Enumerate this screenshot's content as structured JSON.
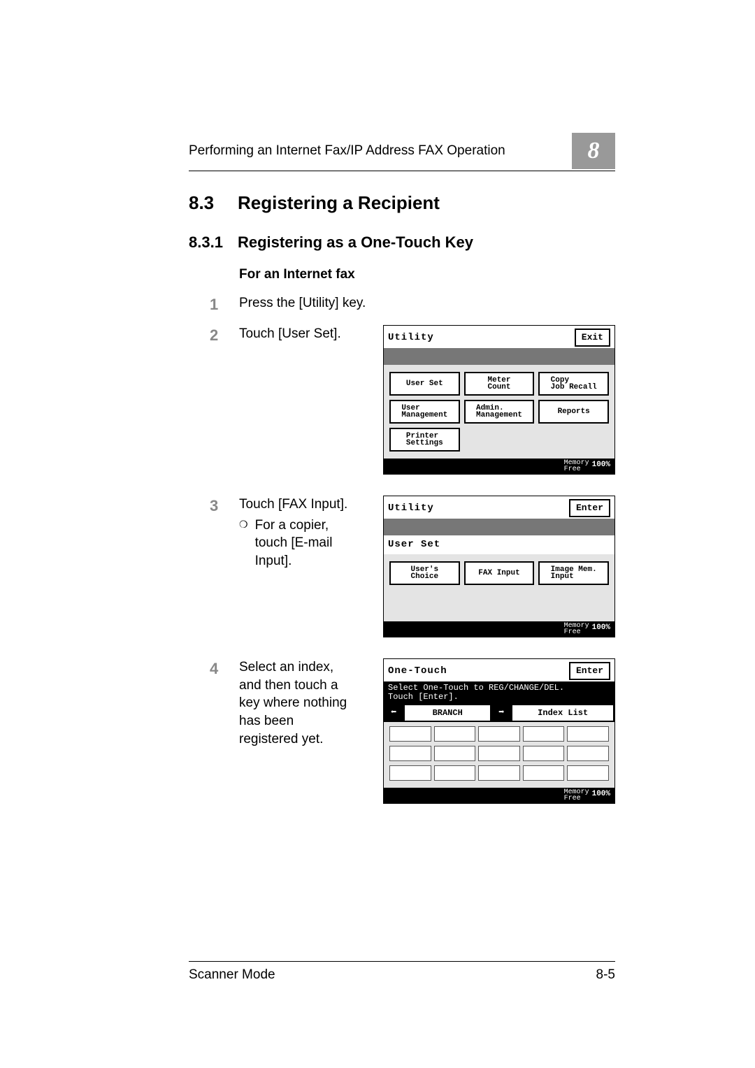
{
  "page": {
    "running_header": "Performing an Internet Fax/IP Address FAX Operation",
    "chapter_number": "8",
    "h2_num": "8.3",
    "h2_title": "Registering a Recipient",
    "h3_num": "8.3.1",
    "h3_title": "Registering as a One-Touch Key",
    "h4": "For an Internet fax",
    "steps": {
      "s1": {
        "n": "1",
        "text": "Press the [Utility] key."
      },
      "s2": {
        "n": "2",
        "text": "Touch [User Set]."
      },
      "s3": {
        "n": "3",
        "text": "Touch [FAX Input].",
        "note": "For a copier, touch [E-mail Input]."
      },
      "s4": {
        "n": "4",
        "text": "Select an index, and then touch a key where nothing has been registered yet."
      }
    },
    "footer_left": "Scanner Mode",
    "footer_right": "8-5"
  },
  "lcd1": {
    "title": "Utility",
    "exit": "Exit",
    "buttons": {
      "user_set": "User Set",
      "meter_count": "Meter\nCount",
      "copy_job_recall": "Copy\nJob Recall",
      "user_management": "User\nManagement",
      "admin_management": "Admin.\nManagement",
      "reports": "Reports",
      "printer_settings": "Printer\nSettings"
    },
    "memory_label": "Memory\nFree",
    "memory_value": "100%"
  },
  "lcd2": {
    "title": "Utility",
    "enter": "Enter",
    "subtitle": "User Set",
    "buttons": {
      "users_choice": "User's\nChoice",
      "fax_input": "FAX Input",
      "image_mem_input": "Image Mem.\nInput"
    },
    "memory_label": "Memory\nFree",
    "memory_value": "100%"
  },
  "lcd3": {
    "title": "One-Touch",
    "enter": "Enter",
    "message_line1": "Select One-Touch to REG/CHANGE/DEL.",
    "message_line2": "Touch [Enter].",
    "tab_branch": "BRANCH",
    "tab_indexlist": "Index List",
    "memory_label": "Memory\nFree",
    "memory_value": "100%"
  }
}
